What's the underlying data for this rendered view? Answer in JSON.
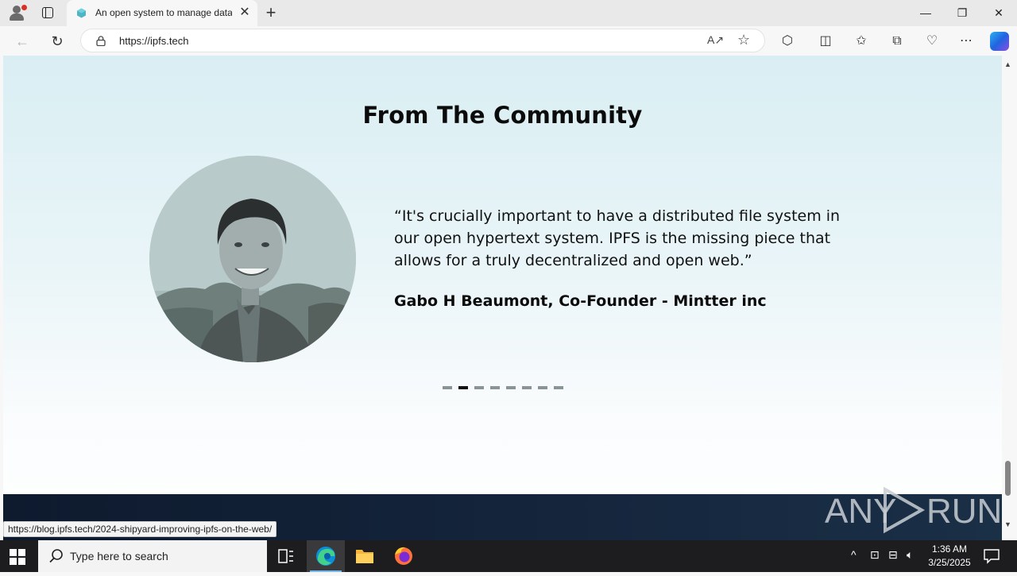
{
  "browser": {
    "tab": {
      "title": "An open system to manage data without a central server"
    },
    "address": {
      "url": "https://ipfs.tech"
    },
    "window_buttons": {
      "minimize": "—",
      "restore": "❐",
      "close": "✕"
    },
    "new_tab": "+",
    "tab_close": "✕"
  },
  "page": {
    "heading": "From The Community",
    "quote": "“It's crucially important to have a distributed file system in our open hypertext system. IPFS is the missing piece that allows for a truly decentralized and open web.”",
    "author": "Gabo H Beaumont, Co-Founder - Mintter inc",
    "carousel": {
      "count": 8,
      "active_index": 1
    },
    "status_url": "https://blog.ipfs.tech/2024-shipyard-improving-ipfs-on-the-web/",
    "watermark": "ANY RUN"
  },
  "taskbar": {
    "search_placeholder": "Type here to search",
    "time": "1:36 AM",
    "date": "3/25/2025"
  },
  "colors": {
    "accent": "#0078d4",
    "footer": "#15263d"
  }
}
